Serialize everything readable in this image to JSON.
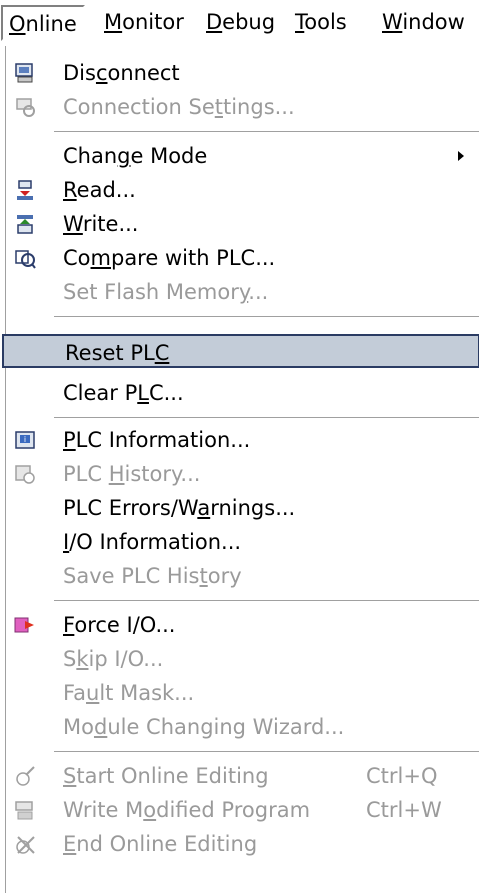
{
  "menubar": [
    {
      "pre": "",
      "ul": "O",
      "post": "nline"
    },
    {
      "pre": "",
      "ul": "M",
      "post": "onitor"
    },
    {
      "pre": "",
      "ul": "D",
      "post": "ebug"
    },
    {
      "pre": "",
      "ul": "T",
      "post": "ools"
    },
    {
      "pre": "",
      "ul": "W",
      "post": "indow"
    }
  ],
  "menu": {
    "items": [
      {
        "pre": "Dis",
        "ul": "c",
        "post": "onnect",
        "disabled": false,
        "icon": "disconnect-icon"
      },
      {
        "pre": "Connection Se",
        "ul": "t",
        "post": "tings...",
        "disabled": true,
        "icon": "connection-settings-icon"
      },
      {
        "pre": "Chan",
        "ul": "g",
        "post": "e Mode",
        "disabled": false,
        "submenu": true
      },
      {
        "pre": "",
        "ul": "R",
        "post": "ead...",
        "disabled": false,
        "icon": "read-icon"
      },
      {
        "pre": "",
        "ul": "W",
        "post": "rite...",
        "disabled": false,
        "icon": "write-icon"
      },
      {
        "pre": "Co",
        "ul": "m",
        "post": "pare with PLC...",
        "disabled": false,
        "icon": "compare-icon"
      },
      {
        "pre": "Set Flash Memor",
        "ul": "y",
        "post": "...",
        "disabled": true
      },
      {
        "pre": "Reset PL",
        "ul": "C",
        "post": "",
        "disabled": false,
        "highlighted": true
      },
      {
        "pre": "Clear P",
        "ul": "L",
        "post": "C...",
        "disabled": false
      },
      {
        "pre": "",
        "ul": "P",
        "post": "LC Information...",
        "disabled": false,
        "icon": "plc-information-icon"
      },
      {
        "pre": "PLC ",
        "ul": "H",
        "post": "istory...",
        "disabled": true,
        "icon": "plc-history-icon"
      },
      {
        "pre": "PLC Errors/W",
        "ul": "a",
        "post": "rnings...",
        "disabled": false
      },
      {
        "pre": "",
        "ul": "I",
        "post": "/O Information...",
        "disabled": false
      },
      {
        "pre": "Save PLC His",
        "ul": "t",
        "post": "ory",
        "disabled": true
      },
      {
        "pre": "",
        "ul": "F",
        "post": "orce I/O...",
        "disabled": false,
        "icon": "force-io-icon"
      },
      {
        "pre": "S",
        "ul": "k",
        "post": "ip I/O...",
        "disabled": true
      },
      {
        "pre": "Fa",
        "ul": "u",
        "post": "lt Mask...",
        "disabled": true
      },
      {
        "pre": "Mo",
        "ul": "d",
        "post": "ule Changing Wizard...",
        "disabled": true
      },
      {
        "pre": "",
        "ul": "S",
        "post": "tart Online Editing",
        "disabled": true,
        "shortcut": "Ctrl+Q",
        "icon": "start-online-editing-icon"
      },
      {
        "pre": "Write M",
        "ul": "o",
        "post": "dified Program",
        "disabled": true,
        "shortcut": "Ctrl+W",
        "icon": "write-modified-program-icon"
      },
      {
        "pre": "",
        "ul": "E",
        "post": "nd Online Editing",
        "disabled": true,
        "icon": "end-online-editing-icon"
      }
    ]
  }
}
